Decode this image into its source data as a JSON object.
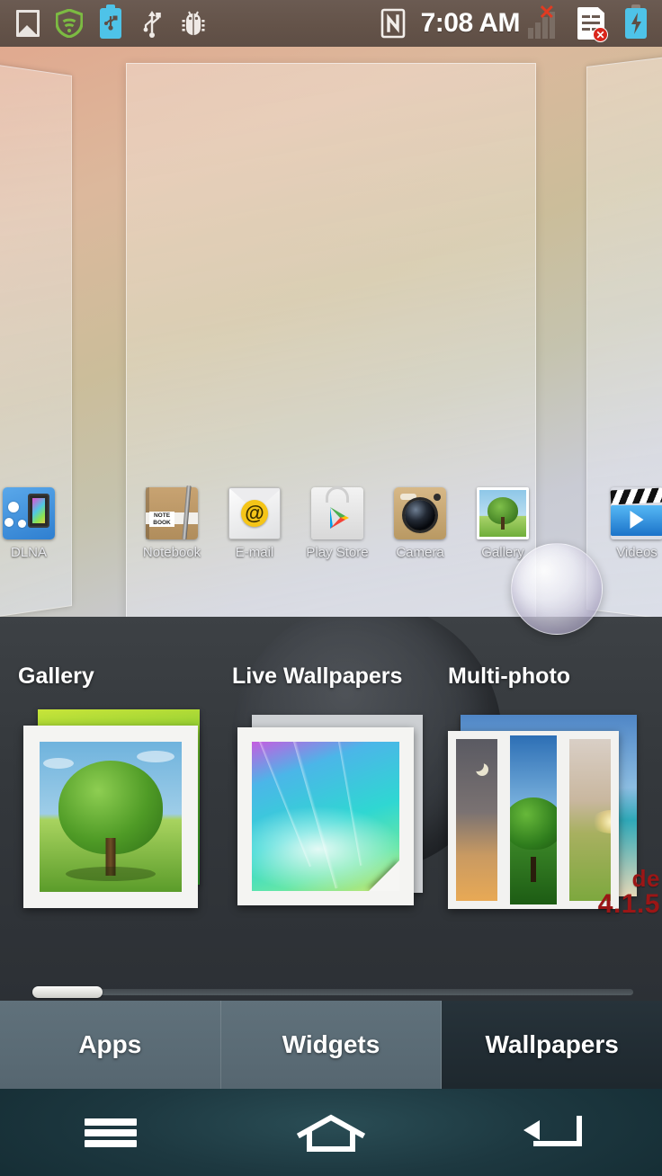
{
  "status_bar": {
    "time": "7:08 AM",
    "left_icons": [
      {
        "name": "gallery-picture-icon",
        "label": "picture"
      },
      {
        "name": "wifi-shield-icon",
        "label": "wifi-shield"
      },
      {
        "name": "battery-usb-icon",
        "label": "battery-usb"
      },
      {
        "name": "usb-icon",
        "label": "usb"
      },
      {
        "name": "usb-debug-bug-icon",
        "label": "usb-debugging"
      }
    ],
    "right_icons": [
      {
        "name": "nfc-icon",
        "label": "nfc"
      },
      {
        "name": "signal-bars-icon",
        "label": "no-signal",
        "badge": "×"
      },
      {
        "name": "sim-card-error-icon",
        "label": "no-sim",
        "badge": "×"
      },
      {
        "name": "battery-charging-icon",
        "label": "charging"
      }
    ],
    "colors": {
      "bar_bg": "#645349",
      "accent_cyan": "#4ec3e8",
      "error_red": "#d9261c",
      "signal_grey": "#7a6d64"
    }
  },
  "home_preview": {
    "pages": [
      {
        "name": "page-left",
        "position": "left"
      },
      {
        "name": "page-center",
        "position": "center"
      },
      {
        "name": "page-right",
        "position": "right"
      }
    ],
    "left_apps": [
      {
        "name": "dlna",
        "label": "DLNA"
      }
    ],
    "dock_apps": [
      {
        "name": "notebook",
        "label": "Notebook",
        "badge_text": "NOTE\nBOOK"
      },
      {
        "name": "email",
        "label": "E-mail",
        "glyph": "@"
      },
      {
        "name": "play-store",
        "label": "Play Store"
      },
      {
        "name": "camera",
        "label": "Camera"
      },
      {
        "name": "gallery",
        "label": "Gallery"
      }
    ],
    "right_apps": [
      {
        "name": "videos",
        "label": "Videos"
      }
    ],
    "notebook_badge_line1": "NOTE",
    "notebook_badge_line2": "BOOK",
    "email_at": "@"
  },
  "wallpaper_picker": {
    "options": [
      {
        "name": "gallery",
        "title": "Gallery",
        "thumb": "tree-photo-stack"
      },
      {
        "name": "live-wallpapers",
        "title": "Live Wallpapers",
        "thumb": "gradient-photo-curl"
      },
      {
        "name": "multi-photo",
        "title": "Multi-photo",
        "thumb": "folded-triptych"
      }
    ],
    "scrollbar": {
      "name": "horizontal-scrollbar",
      "thumb_position": "left",
      "thumb_fraction": "0.11"
    },
    "watermark": {
      "line1": "de",
      "line2": "4.1.5",
      "color": "#9b1616"
    },
    "colors": {
      "panel_bg": "#34383c",
      "title_text": "#ffffff"
    }
  },
  "tabs": [
    {
      "name": "tab-apps",
      "label": "Apps",
      "active": false
    },
    {
      "name": "tab-widgets",
      "label": "Widgets",
      "active": false
    },
    {
      "name": "tab-wallpapers",
      "label": "Wallpapers",
      "active": true
    }
  ],
  "nav_bar": {
    "buttons": [
      {
        "name": "menu-button",
        "icon": "hamburger-menu-icon"
      },
      {
        "name": "home-button",
        "icon": "home-house-icon"
      },
      {
        "name": "back-button",
        "icon": "back-arrow-icon"
      }
    ],
    "colors": {
      "bg": "#1d3840",
      "icon": "#ffffff"
    }
  }
}
